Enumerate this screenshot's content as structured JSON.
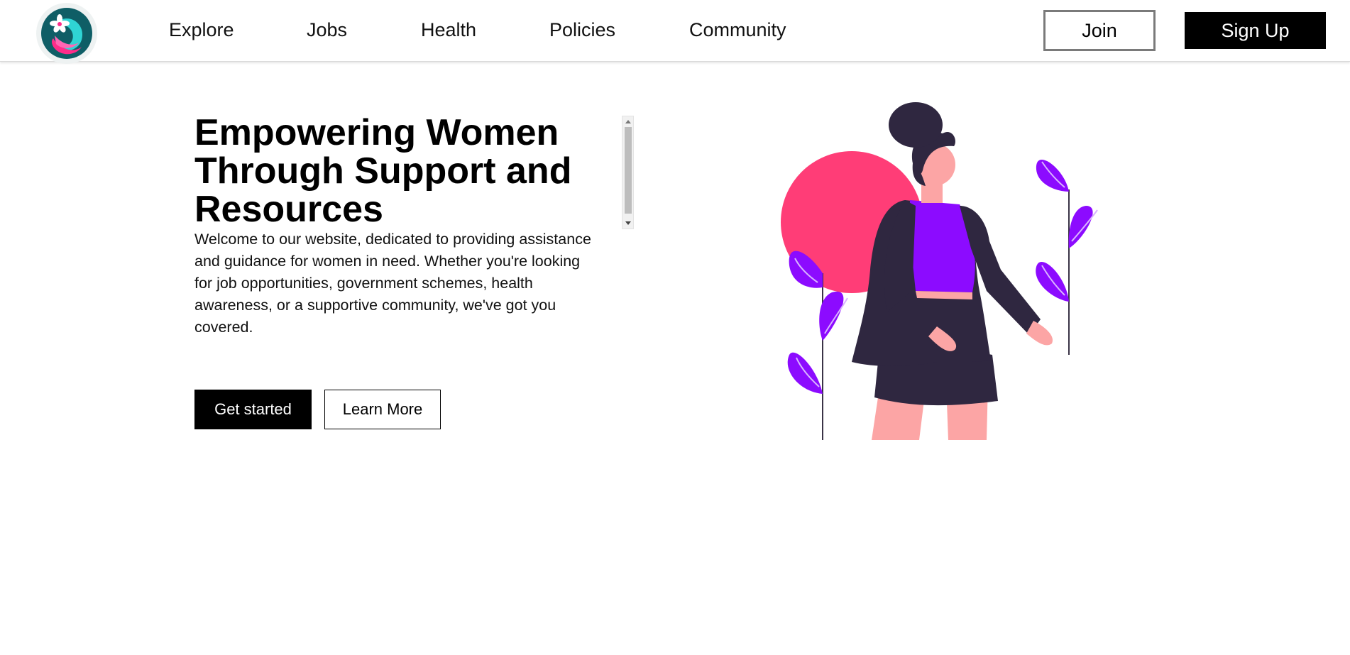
{
  "header": {
    "logo_alt": "site-logo",
    "nav": [
      {
        "label": "Explore"
      },
      {
        "label": "Jobs"
      },
      {
        "label": "Health"
      },
      {
        "label": "Policies"
      },
      {
        "label": "Community"
      }
    ],
    "join_label": "Join",
    "signup_label": "Sign Up"
  },
  "hero": {
    "title": "Empowering Women Through Support and Resources",
    "description": "Welcome to our website, dedicated to providing assistance and guidance for women in need. Whether you're looking for job opportunities, government schemes, health awareness, or a supportive community, we've got you covered.",
    "primary_button": "Get started",
    "secondary_button": "Learn More"
  },
  "colors": {
    "accent_pink": "#ff3d77",
    "accent_purple": "#8c0bff",
    "dark": "#2f2740",
    "skin": "#fca5a5"
  },
  "icons": {
    "logo": "woman-flower-logo-icon",
    "illustration": "woman-with-plants-illustration"
  }
}
